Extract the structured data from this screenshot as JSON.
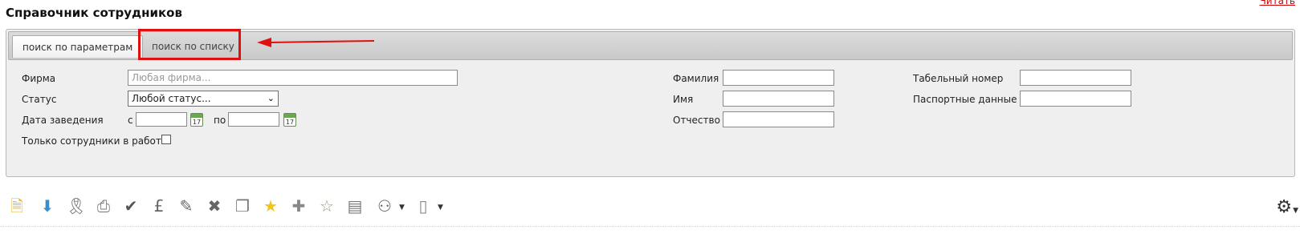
{
  "page": {
    "title": "Справочник сотрудников",
    "corner_link": "Читать"
  },
  "tabs": [
    {
      "label": "поиск по параметрам",
      "active": true
    },
    {
      "label": "поиск по списку",
      "active": false,
      "highlighted": true
    }
  ],
  "annotation": {
    "highlight_color": "#e01010"
  },
  "form": {
    "firm_label": "Фирма",
    "firm_placeholder": "Любая фирма...",
    "status_label": "Статус",
    "status_value": "Любой статус...",
    "date_label": "Дата заведения",
    "date_from_label": "с",
    "date_to_label": "по",
    "calendar_day": "17",
    "active_only_label": "Только сотрудники в работе",
    "surname_label": "Фамилия",
    "name_label": "Имя",
    "patronymic_label": "Отчество",
    "tab_number_label": "Табельный номер",
    "passport_label": "Паспортные данные"
  },
  "toolbar": {
    "icons": [
      "new-document-icon",
      "download-icon",
      "award-ribbon-icon",
      "print-icon",
      "award-check-icon",
      "card-pound-icon",
      "card-edit-icon",
      "card-delete-icon",
      "stack-icon",
      "star-icon",
      "star-add-icon",
      "star-remove-icon",
      "cards-icon",
      "users-dropdown-icon",
      "document-dropdown-icon"
    ],
    "settings_icon": "gear-icon"
  }
}
